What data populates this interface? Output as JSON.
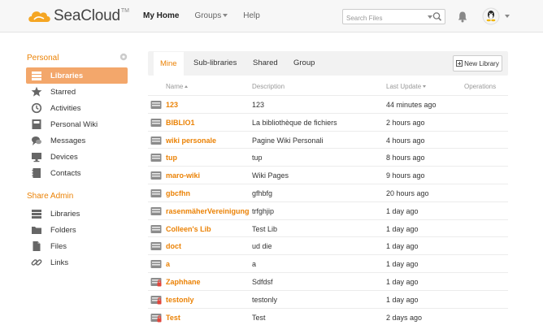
{
  "header": {
    "logo_text": "SeaCloud",
    "logo_tm": "TM",
    "nav": [
      {
        "label": "My Home"
      },
      {
        "label": "Groups"
      },
      {
        "label": "Help"
      }
    ],
    "search_placeholder": "Search Files"
  },
  "sidebar": {
    "personal_title": "Personal",
    "personal_items": [
      {
        "label": "Libraries",
        "icon": "library-icon"
      },
      {
        "label": "Starred",
        "icon": "star-icon"
      },
      {
        "label": "Activities",
        "icon": "clock-icon"
      },
      {
        "label": "Personal Wiki",
        "icon": "wiki-icon"
      },
      {
        "label": "Messages",
        "icon": "messages-icon"
      },
      {
        "label": "Devices",
        "icon": "monitor-icon"
      },
      {
        "label": "Contacts",
        "icon": "contacts-icon"
      }
    ],
    "admin_title": "Share Admin",
    "admin_items": [
      {
        "label": "Libraries",
        "icon": "library-icon"
      },
      {
        "label": "Folders",
        "icon": "folder-icon"
      },
      {
        "label": "Files",
        "icon": "file-icon"
      },
      {
        "label": "Links",
        "icon": "link-icon"
      }
    ]
  },
  "main": {
    "tabs": [
      {
        "label": "Mine"
      },
      {
        "label": "Sub-libraries"
      },
      {
        "label": "Shared"
      },
      {
        "label": "Group"
      }
    ],
    "new_library_label": "New Library",
    "columns": {
      "name": "Name",
      "description": "Description",
      "last_update": "Last Update",
      "operations": "Operations"
    },
    "rows": [
      {
        "name": "123",
        "description": "123",
        "last_update": "44 minutes ago",
        "locked": false
      },
      {
        "name": "BIBLIO1",
        "description": "La bibliothèque de fichiers",
        "last_update": "2 hours ago",
        "locked": false
      },
      {
        "name": "wiki personale",
        "description": "Pagine Wiki Personali",
        "last_update": "4 hours ago",
        "locked": false
      },
      {
        "name": "tup",
        "description": "tup",
        "last_update": "8 hours ago",
        "locked": false
      },
      {
        "name": "maro-wiki",
        "description": "Wiki Pages",
        "last_update": "9 hours ago",
        "locked": false
      },
      {
        "name": "gbcfhn",
        "description": "gfhbfg",
        "last_update": "20 hours ago",
        "locked": false
      },
      {
        "name": "rasenmäherVereinigung",
        "description": "trfghjip",
        "last_update": "1 day ago",
        "locked": false
      },
      {
        "name": "Colleen's Lib",
        "description": "Test Lib",
        "last_update": "1 day ago",
        "locked": false
      },
      {
        "name": "doct",
        "description": "ud die",
        "last_update": "1 day ago",
        "locked": false
      },
      {
        "name": "a",
        "description": "a",
        "last_update": "1 day ago",
        "locked": false
      },
      {
        "name": "Zaphhane",
        "description": "Sdfdsf",
        "last_update": "1 day ago",
        "locked": true
      },
      {
        "name": "testonly",
        "description": "testonly",
        "last_update": "1 day ago",
        "locked": true
      },
      {
        "name": "Test",
        "description": "Test",
        "last_update": "2 days ago",
        "locked": true
      }
    ]
  },
  "colors": {
    "accent": "#eb8205",
    "active_bg": "#f3a76b"
  }
}
